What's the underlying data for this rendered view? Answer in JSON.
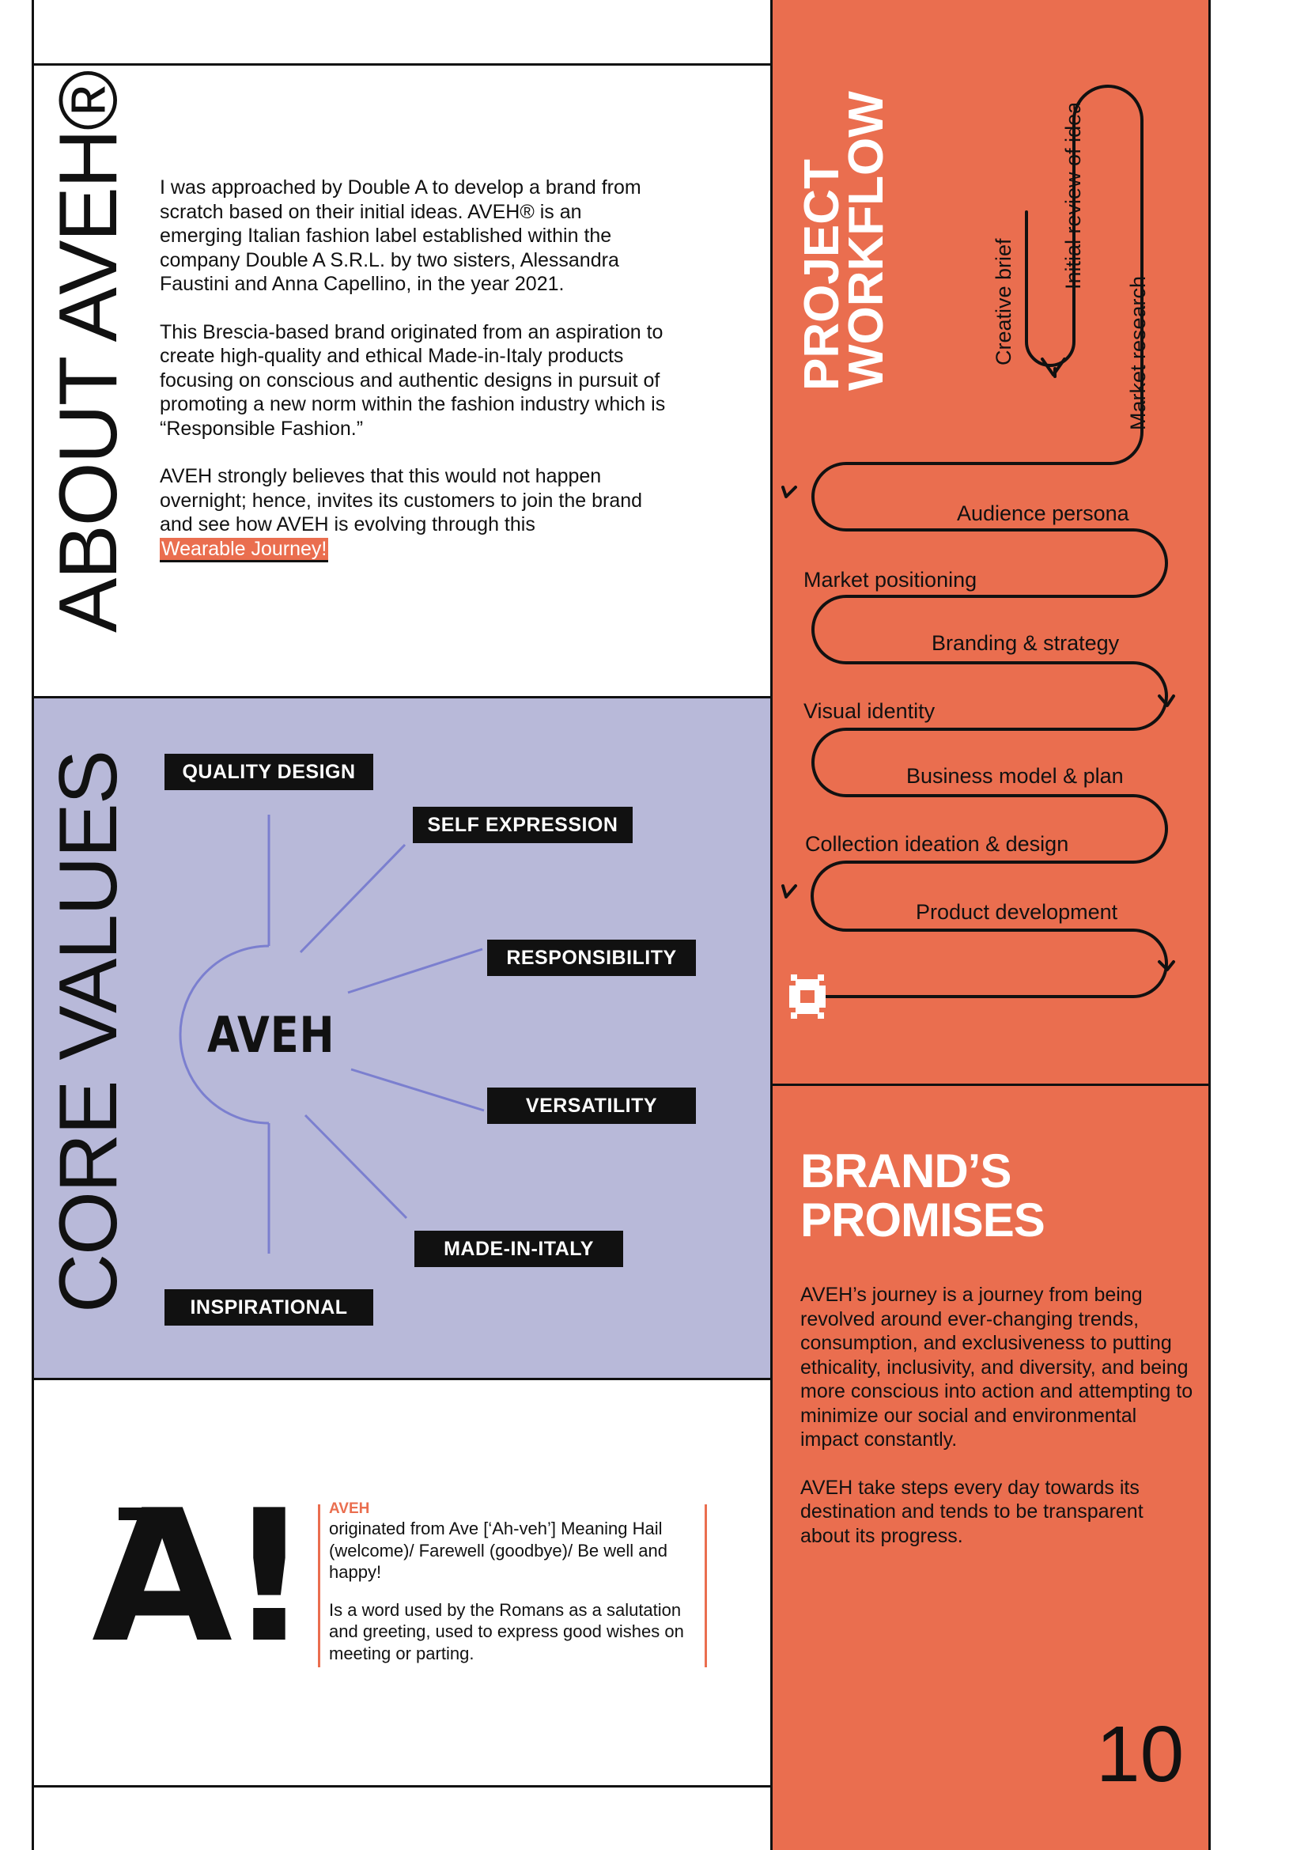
{
  "about": {
    "title": "ABOUT AVEH®",
    "paragraphs": [
      "I was approached by Double A to develop a brand from scratch based on their initial ideas. AVEH® is an emerging Italian fashion label established within the company Double A S.R.L. by two sisters, Alessandra Faustini and Anna Capellino, in the year 2021.",
      "This Brescia-based brand originated from an aspiration to create high-quality and ethical Made-in-Italy products focusing on conscious and authentic designs in pursuit of promoting a new norm within the fashion industry which is “Responsible Fashion.”",
      "AVEH strongly believes that this would not happen overnight; hence, invites its customers to join the brand and see how AVEH is evolving through this"
    ],
    "highlight": "Wearable Journey!"
  },
  "core_values": {
    "title": "CORE VALUES",
    "center_logo": "AVEH",
    "values": [
      "QUALITY DESIGN",
      "SELF EXPRESSION",
      "RESPONSIBILITY",
      "VERSATILITY",
      "MADE-IN-ITALY",
      "INSPIRATIONAL"
    ]
  },
  "workflow": {
    "title_line1": "PROJECT",
    "title_line2": "WORKFLOW",
    "vertical_steps": [
      "Creative brief",
      "Initial review of idea",
      "Market research"
    ],
    "steps": [
      "Audience persona",
      "Market positioning",
      "Branding & strategy",
      "Visual identity",
      "Business model & plan",
      "Collection ideation & design",
      "Product development"
    ]
  },
  "promises": {
    "title_line1": "BRAND’S",
    "title_line2": "PROMISES",
    "paragraphs": [
      "AVEH’s journey is a journey from being revolved around ever-changing trends, consumption, and exclusiveness to putting ethicality, inclusivity, and diversity, and being more conscious into action and attempting to minimize our social and environmental impact constantly.",
      "AVEH take steps every day towards its destination and tends to be transparent about its progress."
    ]
  },
  "etymology": {
    "logo": "A!",
    "word": "AVEH",
    "line1": "originated from Ave [‘Ah-veh’] Meaning Hail (welcome)/ Farewell (goodbye)/ Be well and happy!",
    "line2": "Is a word used by the Romans as a salutation and greeting, used to express good wishes on meeting or parting."
  },
  "page_number": "10",
  "colors": {
    "orange": "#ea6e4f",
    "lavender": "#b8b9d9",
    "line": "#7b7fcf",
    "ink": "#111111"
  }
}
